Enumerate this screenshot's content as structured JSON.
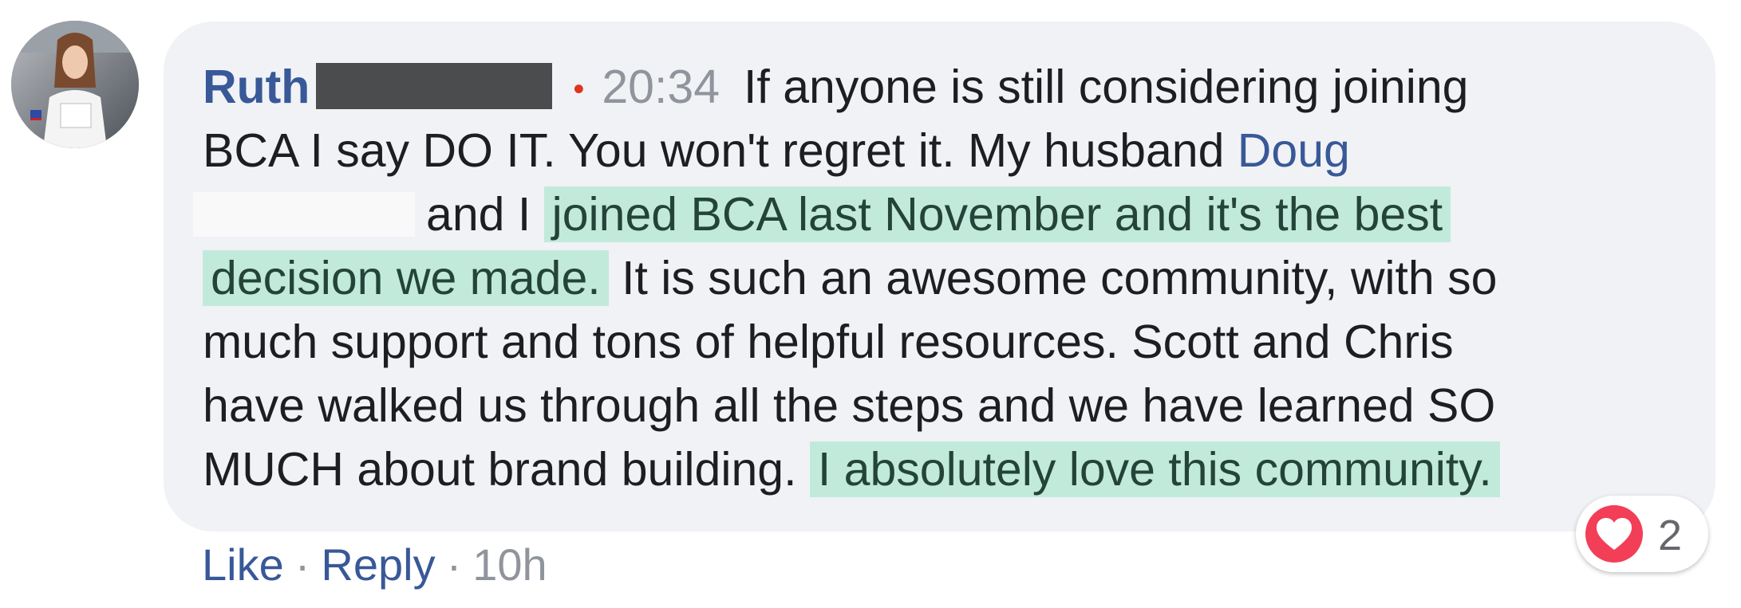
{
  "comment": {
    "author": "Ruth",
    "time": "20:34",
    "line1": "If anyone is still considering joining",
    "line2_text": "BCA I say DO IT. You won't regret it. My husband ",
    "mention": "Doug",
    "line3_prefix": "and I",
    "highlight1_part1": "joined BCA last November and it's the best",
    "highlight1_part2": "decision we made.",
    "line4_rest": "It is such an awesome community, with so",
    "line5": "much support and tons of helpful resources. Scott and Chris",
    "line6": "have walked us through all the steps and we have learned SO",
    "line7_prefix": "MUCH about brand building.",
    "highlight2": "I absolutely love this community."
  },
  "actions": {
    "like": "Like",
    "reply": "Reply",
    "separator": "·",
    "age": "10h"
  },
  "reaction": {
    "icon": "heart-icon",
    "count": "2",
    "color": "#f33e58"
  },
  "colors": {
    "link": "#385898",
    "highlight": "#c2eadb",
    "bubble": "#f0f2f5"
  }
}
